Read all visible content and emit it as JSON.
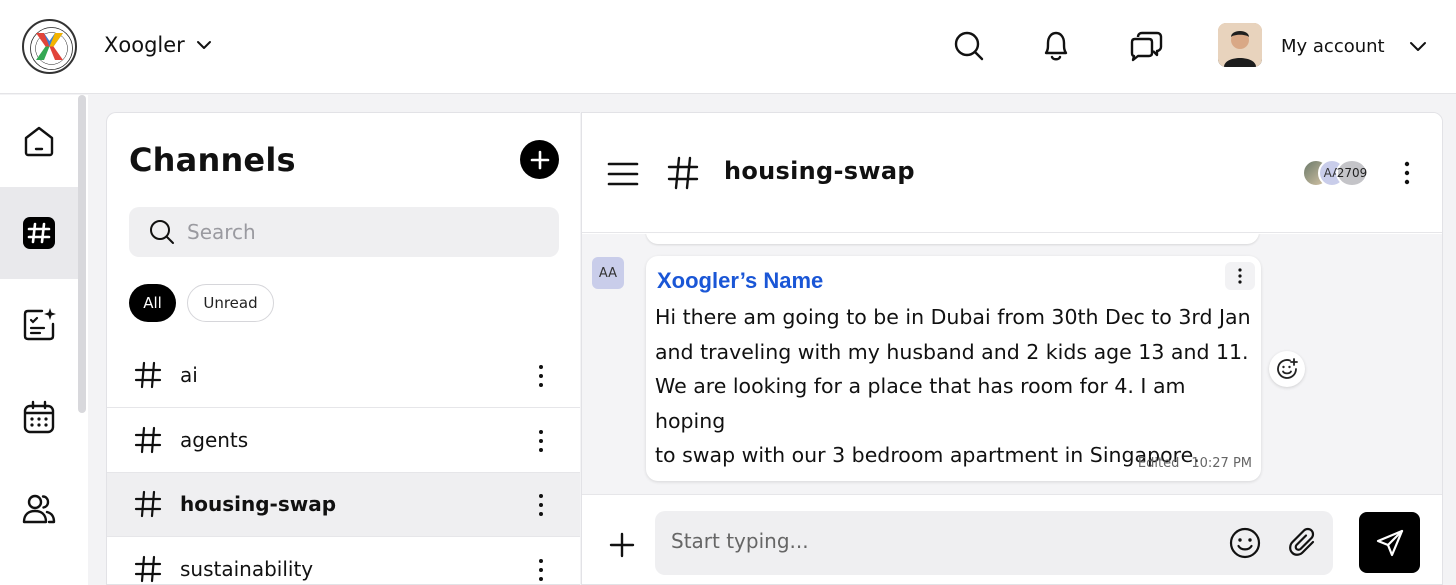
{
  "topbar": {
    "org_name": "Xoogler",
    "account_label": "My account",
    "logo_text": "XOOGLER 2025 · 10TH ANNIVERSARY"
  },
  "channels_panel": {
    "title": "Channels",
    "search_placeholder": "Search",
    "filters": [
      "All",
      "Unread"
    ],
    "items": [
      {
        "name": "ai",
        "active": false
      },
      {
        "name": "agents",
        "active": false
      },
      {
        "name": "housing-swap",
        "active": true
      },
      {
        "name": "sustainability",
        "active": false
      }
    ]
  },
  "chat": {
    "title": "housing-swap",
    "members": {
      "initials": "AA",
      "count_label": "2709"
    },
    "message": {
      "avatar_initials": "AA",
      "sender": "Xoogler’s Name",
      "lines": [
        "Hi there am going to be in Dubai from 30th Dec to 3rd Jan",
        "and traveling with my husband and 2 kids age 13 and 11.",
        "We are looking for a place that has room for 4. I am hoping",
        "to swap with our 3 bedroom apartment in Singapore."
      ],
      "edited_label": "Edited",
      "time": "10:27 PM"
    },
    "composer": {
      "placeholder": "Start typing..."
    }
  },
  "colors": {
    "accent": "#1a56d6",
    "active_bg": "#efeff1",
    "dark": "#000000"
  }
}
